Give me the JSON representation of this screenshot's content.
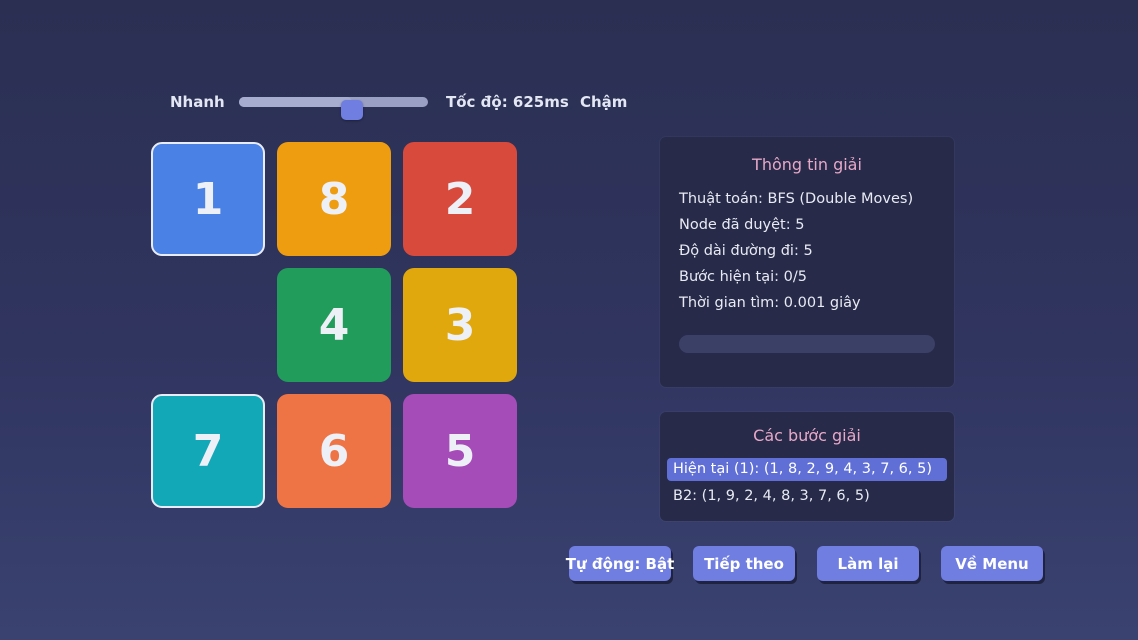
{
  "speed": {
    "fast_label": "Nhanh",
    "slow_label": "Chậm",
    "value_label": "Tốc độ: 625ms",
    "slider_value_ms": 625,
    "slider_fraction": 0.6
  },
  "board": {
    "tiles": [
      {
        "row": 0,
        "col": 0,
        "label": "1",
        "color": "#4a81e5",
        "outlined": true
      },
      {
        "row": 0,
        "col": 1,
        "label": "8",
        "color": "#ee9c10",
        "outlined": false
      },
      {
        "row": 0,
        "col": 2,
        "label": "2",
        "color": "#d84a3c",
        "outlined": false
      },
      {
        "row": 1,
        "col": 1,
        "label": "4",
        "color": "#219c5a",
        "outlined": false
      },
      {
        "row": 1,
        "col": 2,
        "label": "3",
        "color": "#e0a80c",
        "outlined": false
      },
      {
        "row": 2,
        "col": 0,
        "label": "7",
        "color": "#12a8b8",
        "outlined": true
      },
      {
        "row": 2,
        "col": 1,
        "label": "6",
        "color": "#ef7445",
        "outlined": false
      },
      {
        "row": 2,
        "col": 2,
        "label": "5",
        "color": "#a54cb8",
        "outlined": false
      }
    ]
  },
  "info": {
    "title": "Thông tin giải",
    "lines": [
      "Thuật toán: BFS (Double Moves)",
      "Node đã duyệt: 5",
      "Độ dài đường đi: 5",
      "Bước hiện tại: 0/5",
      "Thời gian tìm: 0.001 giây"
    ],
    "progress_fraction": 0
  },
  "steps": {
    "title": "Các bước giải",
    "items": [
      {
        "text": "Hiện tại (1): (1, 8, 2, 9, 4, 3, 7, 6, 5)",
        "active": true
      },
      {
        "text": "B2: (1, 9, 2, 4, 8, 3, 7, 6, 5)",
        "active": false
      }
    ]
  },
  "buttons": {
    "auto": "Tự động: Bật",
    "next": "Tiếp theo",
    "reset": "Làm lại",
    "menu": "Về Menu"
  },
  "colors": {
    "accent": "#6f7ee0",
    "panel_title": "#e7a8c8"
  }
}
